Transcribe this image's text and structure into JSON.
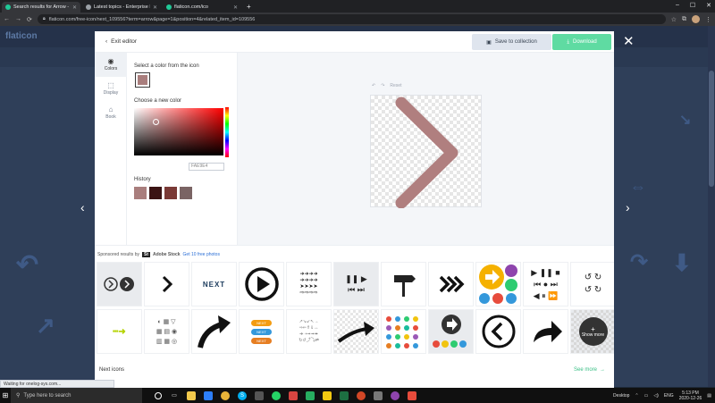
{
  "browser": {
    "tabs": [
      {
        "title": "Search results for Arrow - Flatico",
        "favicon_color": "#20c997",
        "active": true
      },
      {
        "title": "Latest topics - Enterprise DNA Fo",
        "favicon_color": "#9aa0a6",
        "active": false
      },
      {
        "title": "flaticon.com/ico",
        "favicon_color": "#20c997",
        "active": false
      }
    ],
    "new_tab": "+",
    "url": "flaticon.com/free-icon/next_109556?term=arrow&page=1&position=4&related_item_id=109556"
  },
  "page": {
    "logo": "flaticon"
  },
  "editor": {
    "exit_label": "Exit editor",
    "save_label": "Save to collection",
    "download_label": "Download",
    "tools": [
      {
        "name": "Colors",
        "icon": "palette-icon",
        "glyph": "◉"
      },
      {
        "name": "Display",
        "icon": "resize-icon",
        "glyph": "⬚"
      },
      {
        "name": "Book",
        "icon": "book-icon",
        "glyph": "⌂"
      }
    ],
    "select_color_title": "Select a color from the icon",
    "selected_color": "#a97e7d",
    "choose_color_title": "Choose a new color",
    "hex_value": "FAE9E4",
    "history_title": "History",
    "history_colors": [
      "#a97e7d",
      "#3b1414",
      "#7a3a36",
      "#7a6464"
    ],
    "undo_label": "Reset",
    "icon_color": "#b07f7f"
  },
  "related": {
    "sponsored_text": "Sponsored results by",
    "sponsor_brand": "Adobe Stock",
    "sponsor_badge": "St",
    "free_photos": "Get 10 free photos",
    "next_icons_label": "Next icons",
    "see_more_label": "See more",
    "show_more_label": "Show more",
    "next_text": "NEXT"
  },
  "status_bar": "Waiting for onelog-sys.com...",
  "taskbar": {
    "search_placeholder": "Type here to search",
    "desktop_label": "Desktop",
    "lang": "ENG",
    "time": "5:13 PM",
    "date": "2020-12-26"
  }
}
